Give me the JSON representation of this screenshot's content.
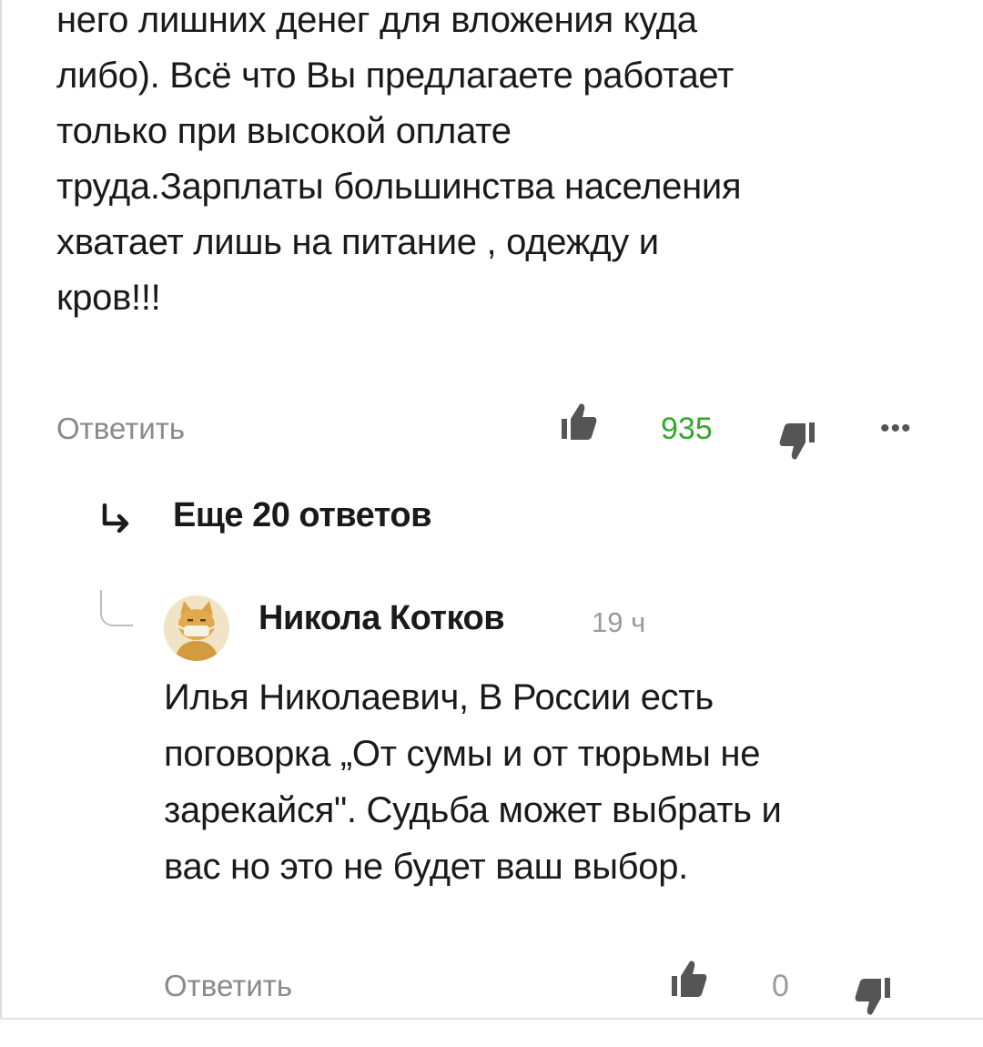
{
  "top_comment": {
    "text_lines": [
      "него лишних денег для вложения куда",
      "либо). Всё что Вы предлагаете работает",
      "только при высокой оплате",
      "труда.Зарплаты большинства населения",
      "хватает лишь на питание , одежду и",
      "кров!!!"
    ],
    "reply_label": "Ответить",
    "likes": "935",
    "more_label": "•••",
    "likes_color": "#35a82a"
  },
  "more_replies": {
    "label": "Еще 20 ответов"
  },
  "reply": {
    "author": "Никола Котков",
    "time": "19 ч",
    "text_lines": [
      "Илья Николаевич, В России есть",
      "поговорка „От сумы и от тюрьмы не",
      "зарекайся\". Судьба может выбрать и",
      "вас но это не будет ваш выбор."
    ],
    "reply_label": "Ответить",
    "likes": "0",
    "likes_color": "#9a9a9a"
  },
  "icons": {
    "like": "thumbs-up-icon",
    "dislike": "thumbs-down-icon",
    "more": "more-dots-icon",
    "arrow": "reply-arrow-icon",
    "avatar": "cat-avatar-icon"
  },
  "colors": {
    "text": "#1a1a1a",
    "muted": "#8a8a8a",
    "positive": "#35a82a"
  }
}
